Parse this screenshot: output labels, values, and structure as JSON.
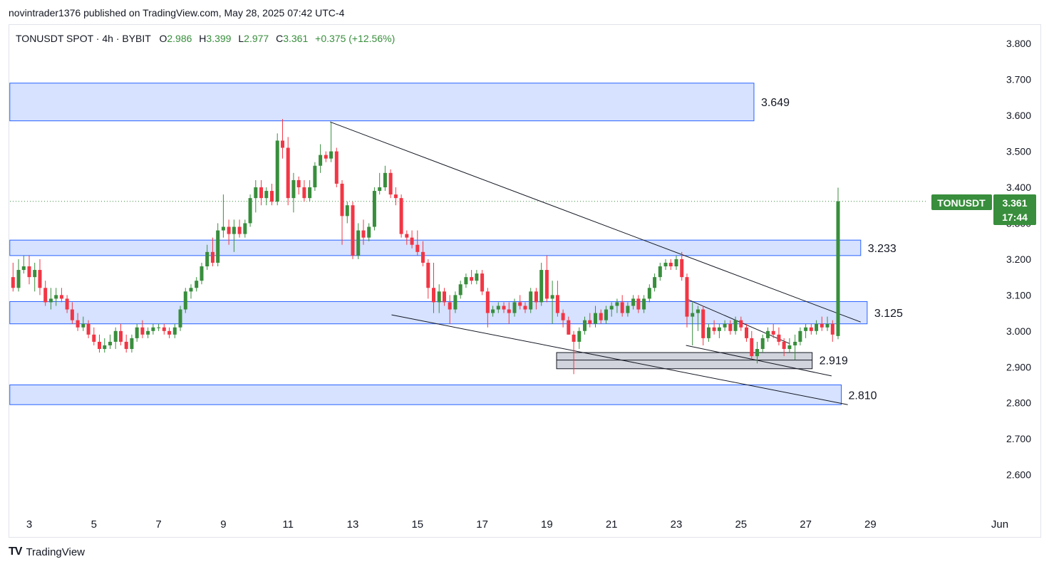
{
  "header": {
    "publish_line": "novintrader1376 published on TradingView.com, May 28, 2025 07:42 UTC-4"
  },
  "legend": {
    "symbol": "TONUSDT SPOT · 4h · BYBIT",
    "o_label": "O",
    "o_value": "2.986",
    "h_label": "H",
    "h_value": "3.399",
    "l_label": "L",
    "l_value": "2.977",
    "c_label": "C",
    "c_value": "3.361",
    "change": "+0.375 (+12.56%)"
  },
  "price_tag": {
    "symbol": "TONUSDT",
    "price": "3.361",
    "countdown": "17:44"
  },
  "footer": {
    "logo": "TV",
    "brand": "TradingView"
  },
  "colors": {
    "up": "#388e3c",
    "down": "#f23645",
    "zone_fill": "#d6e2ff",
    "zone_border": "#2962ff",
    "gray_zone": "#d1d4dc",
    "text": "#131722"
  },
  "chart_data": {
    "type": "candlestick",
    "title": "",
    "ylim": [
      2.51,
      3.85
    ],
    "y_ticks": [
      "3.800",
      "3.700",
      "3.600",
      "3.500",
      "3.400",
      "3.300",
      "3.200",
      "3.100",
      "3.000",
      "2.900",
      "2.800",
      "2.700",
      "2.600"
    ],
    "x_ticks": [
      "3",
      "5",
      "7",
      "9",
      "11",
      "13",
      "15",
      "17",
      "19",
      "21",
      "23",
      "25",
      "27",
      "29",
      "Jun"
    ],
    "x_tick_days": [
      3,
      5,
      7,
      9,
      11,
      13,
      15,
      17,
      19,
      21,
      23,
      25,
      27,
      29,
      33
    ],
    "last_price": 3.361,
    "zones": [
      {
        "label": "3.649",
        "top": 3.69,
        "bottom": 3.585,
        "from_day": 2.4,
        "to_day": 25.4
      },
      {
        "label": "3.233",
        "top": 3.253,
        "bottom": 3.21,
        "from_day": 2.4,
        "to_day": 28.7
      },
      {
        "label": "3.125",
        "top": 3.082,
        "bottom": 3.02,
        "from_day": 2.4,
        "to_day": 28.9
      },
      {
        "label": "2.810",
        "top": 2.85,
        "bottom": 2.795,
        "from_day": 2.4,
        "to_day": 28.1
      }
    ],
    "gray_zone": {
      "label": "2.919",
      "top": 2.94,
      "bottom": 2.895,
      "mid": 2.919,
      "from_day": 19.3,
      "to_day": 27.2
    },
    "trendlines": [
      {
        "from": [
          12.3,
          3.582
        ],
        "to": [
          28.7,
          3.025
        ]
      },
      {
        "from": [
          14.2,
          3.045
        ],
        "to": [
          28.3,
          2.795
        ]
      },
      {
        "from": [
          23.3,
          3.09
        ],
        "to": [
          26.5,
          2.965
        ]
      },
      {
        "from": [
          23.3,
          2.96
        ],
        "to": [
          27.8,
          2.875
        ]
      }
    ],
    "candles": [
      {
        "d": 2.5,
        "o": 3.15,
        "h": 3.19,
        "l": 3.11,
        "c": 3.12
      },
      {
        "d": 2.67,
        "o": 3.12,
        "h": 3.2,
        "l": 3.11,
        "c": 3.17
      },
      {
        "d": 2.83,
        "o": 3.17,
        "h": 3.21,
        "l": 3.16,
        "c": 3.18
      },
      {
        "d": 3.0,
        "o": 3.18,
        "h": 3.21,
        "l": 3.13,
        "c": 3.15
      },
      {
        "d": 3.17,
        "o": 3.15,
        "h": 3.19,
        "l": 3.11,
        "c": 3.17
      },
      {
        "d": 3.33,
        "o": 3.17,
        "h": 3.2,
        "l": 3.1,
        "c": 3.12
      },
      {
        "d": 3.5,
        "o": 3.12,
        "h": 3.14,
        "l": 3.07,
        "c": 3.08
      },
      {
        "d": 3.67,
        "o": 3.08,
        "h": 3.12,
        "l": 3.06,
        "c": 3.09
      },
      {
        "d": 3.83,
        "o": 3.09,
        "h": 3.12,
        "l": 3.07,
        "c": 3.1
      },
      {
        "d": 4.0,
        "o": 3.1,
        "h": 3.12,
        "l": 3.08,
        "c": 3.09
      },
      {
        "d": 4.17,
        "o": 3.09,
        "h": 3.1,
        "l": 3.05,
        "c": 3.06
      },
      {
        "d": 4.33,
        "o": 3.06,
        "h": 3.08,
        "l": 3.02,
        "c": 3.03
      },
      {
        "d": 4.5,
        "o": 3.03,
        "h": 3.05,
        "l": 3.0,
        "c": 3.01
      },
      {
        "d": 4.67,
        "o": 3.01,
        "h": 3.04,
        "l": 3.0,
        "c": 3.02
      },
      {
        "d": 4.83,
        "o": 3.02,
        "h": 3.03,
        "l": 2.98,
        "c": 2.99
      },
      {
        "d": 5.0,
        "o": 2.99,
        "h": 3.01,
        "l": 2.96,
        "c": 2.97
      },
      {
        "d": 5.17,
        "o": 2.97,
        "h": 2.99,
        "l": 2.94,
        "c": 2.95
      },
      {
        "d": 5.33,
        "o": 2.95,
        "h": 2.98,
        "l": 2.94,
        "c": 2.96
      },
      {
        "d": 5.5,
        "o": 2.96,
        "h": 2.99,
        "l": 2.95,
        "c": 2.97
      },
      {
        "d": 5.67,
        "o": 2.97,
        "h": 3.01,
        "l": 2.95,
        "c": 3.0
      },
      {
        "d": 5.83,
        "o": 3.0,
        "h": 3.02,
        "l": 2.96,
        "c": 2.97
      },
      {
        "d": 6.0,
        "o": 2.97,
        "h": 2.99,
        "l": 2.94,
        "c": 2.95
      },
      {
        "d": 6.17,
        "o": 2.95,
        "h": 2.99,
        "l": 2.94,
        "c": 2.98
      },
      {
        "d": 6.33,
        "o": 2.98,
        "h": 3.02,
        "l": 2.97,
        "c": 3.01
      },
      {
        "d": 6.5,
        "o": 3.01,
        "h": 3.03,
        "l": 2.98,
        "c": 2.99
      },
      {
        "d": 6.67,
        "o": 2.99,
        "h": 3.01,
        "l": 2.98,
        "c": 3.0
      },
      {
        "d": 6.83,
        "o": 3.0,
        "h": 3.02,
        "l": 2.99,
        "c": 3.01
      },
      {
        "d": 7.0,
        "o": 3.01,
        "h": 3.02,
        "l": 3.0,
        "c": 3.01
      },
      {
        "d": 7.17,
        "o": 3.01,
        "h": 3.02,
        "l": 2.99,
        "c": 3.0
      },
      {
        "d": 7.33,
        "o": 3.0,
        "h": 3.01,
        "l": 2.98,
        "c": 2.99
      },
      {
        "d": 7.5,
        "o": 2.99,
        "h": 3.02,
        "l": 2.98,
        "c": 3.01
      },
      {
        "d": 7.67,
        "o": 3.01,
        "h": 3.07,
        "l": 3.0,
        "c": 3.06
      },
      {
        "d": 7.83,
        "o": 3.06,
        "h": 3.12,
        "l": 3.05,
        "c": 3.11
      },
      {
        "d": 8.0,
        "o": 3.11,
        "h": 3.13,
        "l": 3.09,
        "c": 3.12
      },
      {
        "d": 8.17,
        "o": 3.12,
        "h": 3.15,
        "l": 3.11,
        "c": 3.14
      },
      {
        "d": 8.33,
        "o": 3.14,
        "h": 3.19,
        "l": 3.13,
        "c": 3.18
      },
      {
        "d": 8.5,
        "o": 3.18,
        "h": 3.24,
        "l": 3.17,
        "c": 3.22
      },
      {
        "d": 8.67,
        "o": 3.22,
        "h": 3.26,
        "l": 3.18,
        "c": 3.19
      },
      {
        "d": 8.83,
        "o": 3.19,
        "h": 3.3,
        "l": 3.18,
        "c": 3.28
      },
      {
        "d": 9.0,
        "o": 3.28,
        "h": 3.38,
        "l": 3.26,
        "c": 3.29
      },
      {
        "d": 9.17,
        "o": 3.29,
        "h": 3.31,
        "l": 3.24,
        "c": 3.27
      },
      {
        "d": 9.33,
        "o": 3.27,
        "h": 3.31,
        "l": 3.22,
        "c": 3.29
      },
      {
        "d": 9.5,
        "o": 3.29,
        "h": 3.31,
        "l": 3.26,
        "c": 3.27
      },
      {
        "d": 9.67,
        "o": 3.27,
        "h": 3.31,
        "l": 3.26,
        "c": 3.3
      },
      {
        "d": 9.83,
        "o": 3.3,
        "h": 3.38,
        "l": 3.29,
        "c": 3.37
      },
      {
        "d": 10.0,
        "o": 3.37,
        "h": 3.42,
        "l": 3.33,
        "c": 3.4
      },
      {
        "d": 10.17,
        "o": 3.4,
        "h": 3.42,
        "l": 3.35,
        "c": 3.37
      },
      {
        "d": 10.33,
        "o": 3.37,
        "h": 3.4,
        "l": 3.35,
        "c": 3.39
      },
      {
        "d": 10.5,
        "o": 3.39,
        "h": 3.41,
        "l": 3.35,
        "c": 3.36
      },
      {
        "d": 10.67,
        "o": 3.36,
        "h": 3.55,
        "l": 3.35,
        "c": 3.53
      },
      {
        "d": 10.83,
        "o": 3.53,
        "h": 3.59,
        "l": 3.48,
        "c": 3.51
      },
      {
        "d": 11.0,
        "o": 3.51,
        "h": 3.54,
        "l": 3.35,
        "c": 3.37
      },
      {
        "d": 11.17,
        "o": 3.37,
        "h": 3.44,
        "l": 3.33,
        "c": 3.42
      },
      {
        "d": 11.33,
        "o": 3.42,
        "h": 3.43,
        "l": 3.38,
        "c": 3.4
      },
      {
        "d": 11.5,
        "o": 3.4,
        "h": 3.42,
        "l": 3.36,
        "c": 3.37
      },
      {
        "d": 11.67,
        "o": 3.37,
        "h": 3.42,
        "l": 3.36,
        "c": 3.4
      },
      {
        "d": 11.83,
        "o": 3.4,
        "h": 3.47,
        "l": 3.39,
        "c": 3.46
      },
      {
        "d": 12.0,
        "o": 3.46,
        "h": 3.52,
        "l": 3.44,
        "c": 3.49
      },
      {
        "d": 12.17,
        "o": 3.49,
        "h": 3.5,
        "l": 3.47,
        "c": 3.48
      },
      {
        "d": 12.33,
        "o": 3.48,
        "h": 3.58,
        "l": 3.47,
        "c": 3.5
      },
      {
        "d": 12.5,
        "o": 3.5,
        "h": 3.51,
        "l": 3.4,
        "c": 3.41
      },
      {
        "d": 12.67,
        "o": 3.41,
        "h": 3.42,
        "l": 3.24,
        "c": 3.32
      },
      {
        "d": 12.83,
        "o": 3.32,
        "h": 3.36,
        "l": 3.3,
        "c": 3.35
      },
      {
        "d": 13.0,
        "o": 3.35,
        "h": 3.36,
        "l": 3.2,
        "c": 3.21
      },
      {
        "d": 13.17,
        "o": 3.21,
        "h": 3.3,
        "l": 3.2,
        "c": 3.28
      },
      {
        "d": 13.33,
        "o": 3.28,
        "h": 3.31,
        "l": 3.24,
        "c": 3.26
      },
      {
        "d": 13.5,
        "o": 3.26,
        "h": 3.3,
        "l": 3.25,
        "c": 3.29
      },
      {
        "d": 13.67,
        "o": 3.29,
        "h": 3.4,
        "l": 3.28,
        "c": 3.39
      },
      {
        "d": 13.83,
        "o": 3.39,
        "h": 3.44,
        "l": 3.38,
        "c": 3.4
      },
      {
        "d": 14.0,
        "o": 3.4,
        "h": 3.46,
        "l": 3.39,
        "c": 3.44
      },
      {
        "d": 14.17,
        "o": 3.44,
        "h": 3.45,
        "l": 3.37,
        "c": 3.38
      },
      {
        "d": 14.33,
        "o": 3.38,
        "h": 3.4,
        "l": 3.35,
        "c": 3.37
      },
      {
        "d": 14.5,
        "o": 3.37,
        "h": 3.38,
        "l": 3.26,
        "c": 3.27
      },
      {
        "d": 14.67,
        "o": 3.27,
        "h": 3.28,
        "l": 3.24,
        "c": 3.26
      },
      {
        "d": 14.83,
        "o": 3.26,
        "h": 3.28,
        "l": 3.23,
        "c": 3.24
      },
      {
        "d": 15.0,
        "o": 3.24,
        "h": 3.28,
        "l": 3.21,
        "c": 3.22
      },
      {
        "d": 15.17,
        "o": 3.22,
        "h": 3.25,
        "l": 3.18,
        "c": 3.19
      },
      {
        "d": 15.33,
        "o": 3.19,
        "h": 3.2,
        "l": 3.09,
        "c": 3.12
      },
      {
        "d": 15.5,
        "o": 3.12,
        "h": 3.19,
        "l": 3.05,
        "c": 3.08
      },
      {
        "d": 15.67,
        "o": 3.08,
        "h": 3.13,
        "l": 3.05,
        "c": 3.11
      },
      {
        "d": 15.83,
        "o": 3.11,
        "h": 3.12,
        "l": 3.07,
        "c": 3.08
      },
      {
        "d": 16.0,
        "o": 3.08,
        "h": 3.1,
        "l": 3.02,
        "c": 3.06
      },
      {
        "d": 16.17,
        "o": 3.06,
        "h": 3.11,
        "l": 3.05,
        "c": 3.1
      },
      {
        "d": 16.33,
        "o": 3.1,
        "h": 3.14,
        "l": 3.09,
        "c": 3.13
      },
      {
        "d": 16.5,
        "o": 3.13,
        "h": 3.16,
        "l": 3.12,
        "c": 3.15
      },
      {
        "d": 16.67,
        "o": 3.15,
        "h": 3.17,
        "l": 3.13,
        "c": 3.14
      },
      {
        "d": 16.83,
        "o": 3.14,
        "h": 3.17,
        "l": 3.13,
        "c": 3.16
      },
      {
        "d": 17.0,
        "o": 3.16,
        "h": 3.17,
        "l": 3.1,
        "c": 3.11
      },
      {
        "d": 17.17,
        "o": 3.11,
        "h": 3.12,
        "l": 3.01,
        "c": 3.05
      },
      {
        "d": 17.33,
        "o": 3.05,
        "h": 3.07,
        "l": 3.04,
        "c": 3.06
      },
      {
        "d": 17.5,
        "o": 3.06,
        "h": 3.08,
        "l": 3.05,
        "c": 3.07
      },
      {
        "d": 17.67,
        "o": 3.07,
        "h": 3.08,
        "l": 3.05,
        "c": 3.06
      },
      {
        "d": 17.83,
        "o": 3.06,
        "h": 3.08,
        "l": 3.02,
        "c": 3.05
      },
      {
        "d": 18.0,
        "o": 3.05,
        "h": 3.09,
        "l": 3.04,
        "c": 3.08
      },
      {
        "d": 18.17,
        "o": 3.08,
        "h": 3.1,
        "l": 3.06,
        "c": 3.07
      },
      {
        "d": 18.33,
        "o": 3.07,
        "h": 3.08,
        "l": 3.05,
        "c": 3.06
      },
      {
        "d": 18.5,
        "o": 3.06,
        "h": 3.12,
        "l": 3.05,
        "c": 3.11
      },
      {
        "d": 18.67,
        "o": 3.11,
        "h": 3.12,
        "l": 3.06,
        "c": 3.08
      },
      {
        "d": 18.83,
        "o": 3.08,
        "h": 3.19,
        "l": 3.07,
        "c": 3.17
      },
      {
        "d": 19.0,
        "o": 3.17,
        "h": 3.21,
        "l": 3.08,
        "c": 3.09
      },
      {
        "d": 19.17,
        "o": 3.09,
        "h": 3.14,
        "l": 3.02,
        "c": 3.1
      },
      {
        "d": 19.33,
        "o": 3.1,
        "h": 3.14,
        "l": 3.04,
        "c": 3.05
      },
      {
        "d": 19.5,
        "o": 3.05,
        "h": 3.06,
        "l": 3.01,
        "c": 3.03
      },
      {
        "d": 19.67,
        "o": 3.03,
        "h": 3.04,
        "l": 2.99,
        "c": 2.99
      },
      {
        "d": 19.83,
        "o": 2.99,
        "h": 3.0,
        "l": 2.88,
        "c": 2.97
      },
      {
        "d": 20.0,
        "o": 2.97,
        "h": 3.01,
        "l": 2.95,
        "c": 3.0
      },
      {
        "d": 20.17,
        "o": 3.0,
        "h": 3.04,
        "l": 2.99,
        "c": 3.03
      },
      {
        "d": 20.33,
        "o": 3.03,
        "h": 3.05,
        "l": 3.01,
        "c": 3.02
      },
      {
        "d": 20.5,
        "o": 3.02,
        "h": 3.07,
        "l": 3.01,
        "c": 3.05
      },
      {
        "d": 20.67,
        "o": 3.05,
        "h": 3.06,
        "l": 3.02,
        "c": 3.03
      },
      {
        "d": 20.83,
        "o": 3.03,
        "h": 3.07,
        "l": 3.02,
        "c": 3.06
      },
      {
        "d": 21.0,
        "o": 3.06,
        "h": 3.08,
        "l": 3.04,
        "c": 3.07
      },
      {
        "d": 21.17,
        "o": 3.07,
        "h": 3.09,
        "l": 3.05,
        "c": 3.08
      },
      {
        "d": 21.33,
        "o": 3.08,
        "h": 3.1,
        "l": 3.04,
        "c": 3.05
      },
      {
        "d": 21.5,
        "o": 3.05,
        "h": 3.08,
        "l": 3.04,
        "c": 3.07
      },
      {
        "d": 21.67,
        "o": 3.07,
        "h": 3.1,
        "l": 3.06,
        "c": 3.09
      },
      {
        "d": 21.83,
        "o": 3.09,
        "h": 3.1,
        "l": 3.05,
        "c": 3.06
      },
      {
        "d": 22.0,
        "o": 3.06,
        "h": 3.1,
        "l": 3.05,
        "c": 3.09
      },
      {
        "d": 22.17,
        "o": 3.09,
        "h": 3.13,
        "l": 3.08,
        "c": 3.12
      },
      {
        "d": 22.33,
        "o": 3.12,
        "h": 3.16,
        "l": 3.11,
        "c": 3.15
      },
      {
        "d": 22.5,
        "o": 3.15,
        "h": 3.19,
        "l": 3.14,
        "c": 3.18
      },
      {
        "d": 22.67,
        "o": 3.18,
        "h": 3.2,
        "l": 3.17,
        "c": 3.19
      },
      {
        "d": 22.83,
        "o": 3.19,
        "h": 3.2,
        "l": 3.17,
        "c": 3.18
      },
      {
        "d": 23.0,
        "o": 3.18,
        "h": 3.21,
        "l": 3.17,
        "c": 3.2
      },
      {
        "d": 23.17,
        "o": 3.2,
        "h": 3.22,
        "l": 3.14,
        "c": 3.15
      },
      {
        "d": 23.33,
        "o": 3.15,
        "h": 3.16,
        "l": 3.01,
        "c": 3.04
      },
      {
        "d": 23.5,
        "o": 3.04,
        "h": 3.08,
        "l": 2.96,
        "c": 3.05
      },
      {
        "d": 23.67,
        "o": 3.05,
        "h": 3.07,
        "l": 3.0,
        "c": 3.06
      },
      {
        "d": 23.83,
        "o": 3.06,
        "h": 3.07,
        "l": 2.96,
        "c": 2.98
      },
      {
        "d": 24.0,
        "o": 2.98,
        "h": 3.02,
        "l": 2.97,
        "c": 3.01
      },
      {
        "d": 24.17,
        "o": 3.01,
        "h": 3.03,
        "l": 2.99,
        "c": 3.0
      },
      {
        "d": 24.33,
        "o": 3.0,
        "h": 3.02,
        "l": 2.98,
        "c": 3.01
      },
      {
        "d": 24.5,
        "o": 3.01,
        "h": 3.03,
        "l": 3.0,
        "c": 3.02
      },
      {
        "d": 24.67,
        "o": 3.02,
        "h": 3.03,
        "l": 2.99,
        "c": 3.0
      },
      {
        "d": 24.83,
        "o": 3.0,
        "h": 3.04,
        "l": 2.99,
        "c": 3.03
      },
      {
        "d": 25.0,
        "o": 3.03,
        "h": 3.04,
        "l": 3.0,
        "c": 3.01
      },
      {
        "d": 25.17,
        "o": 3.01,
        "h": 3.02,
        "l": 2.97,
        "c": 2.98
      },
      {
        "d": 25.33,
        "o": 2.98,
        "h": 3.0,
        "l": 2.92,
        "c": 2.93
      },
      {
        "d": 25.5,
        "o": 2.93,
        "h": 2.97,
        "l": 2.91,
        "c": 2.95
      },
      {
        "d": 25.67,
        "o": 2.95,
        "h": 2.99,
        "l": 2.94,
        "c": 2.98
      },
      {
        "d": 25.83,
        "o": 2.98,
        "h": 3.01,
        "l": 2.97,
        "c": 3.0
      },
      {
        "d": 26.0,
        "o": 3.0,
        "h": 3.02,
        "l": 2.98,
        "c": 2.99
      },
      {
        "d": 26.17,
        "o": 2.99,
        "h": 3.01,
        "l": 2.96,
        "c": 2.97
      },
      {
        "d": 26.33,
        "o": 2.97,
        "h": 2.98,
        "l": 2.93,
        "c": 2.95
      },
      {
        "d": 26.5,
        "o": 2.95,
        "h": 2.98,
        "l": 2.94,
        "c": 2.96
      },
      {
        "d": 26.67,
        "o": 2.96,
        "h": 2.99,
        "l": 2.92,
        "c": 2.97
      },
      {
        "d": 26.83,
        "o": 2.97,
        "h": 3.01,
        "l": 2.96,
        "c": 3.0
      },
      {
        "d": 27.0,
        "o": 3.0,
        "h": 3.02,
        "l": 2.98,
        "c": 3.01
      },
      {
        "d": 27.17,
        "o": 3.01,
        "h": 3.02,
        "l": 2.99,
        "c": 3.0
      },
      {
        "d": 27.33,
        "o": 3.0,
        "h": 3.03,
        "l": 2.99,
        "c": 3.02
      },
      {
        "d": 27.5,
        "o": 3.02,
        "h": 3.04,
        "l": 3.0,
        "c": 3.01
      },
      {
        "d": 27.67,
        "o": 3.01,
        "h": 3.04,
        "l": 3.0,
        "c": 3.02
      },
      {
        "d": 27.83,
        "o": 3.02,
        "h": 3.03,
        "l": 2.97,
        "c": 2.99
      },
      {
        "d": 28.0,
        "o": 2.986,
        "h": 3.399,
        "l": 2.977,
        "c": 3.361
      }
    ]
  }
}
